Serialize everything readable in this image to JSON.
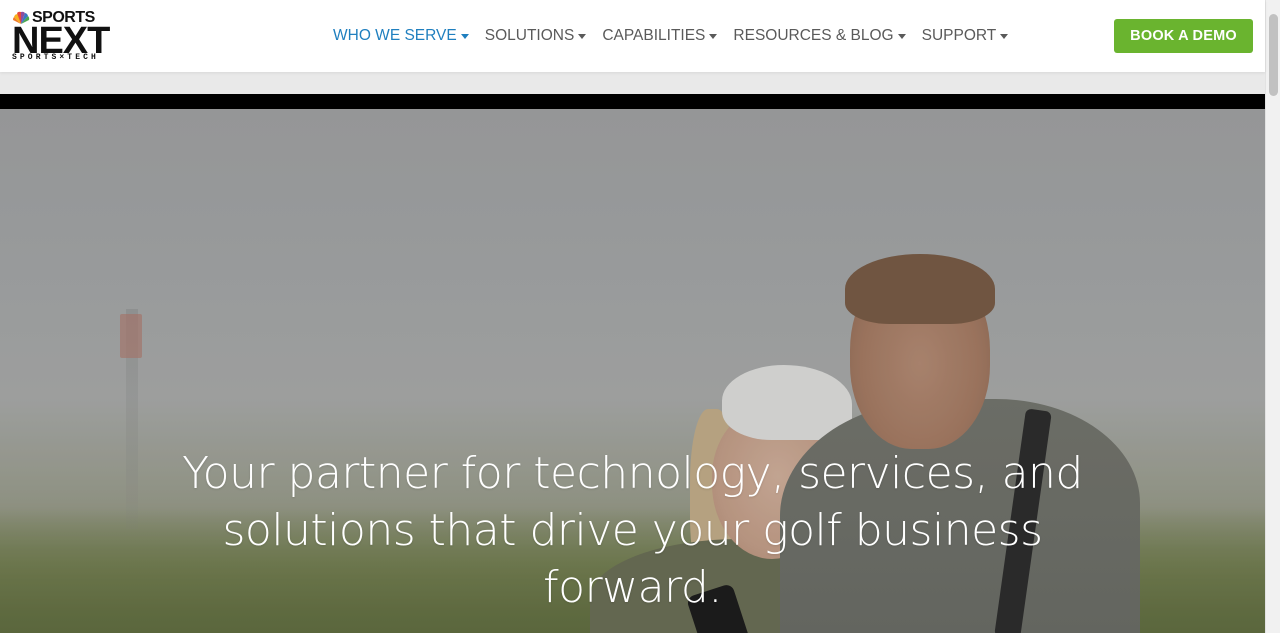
{
  "logo": {
    "top_word": "SPORTS",
    "main_word": "NEXT",
    "sub_text": "SPORTS×TECH",
    "icon": "peacock-icon"
  },
  "nav": {
    "items": [
      {
        "label": "WHO WE SERVE",
        "active": true
      },
      {
        "label": "SOLUTIONS",
        "active": false
      },
      {
        "label": "CAPABILITIES",
        "active": false
      },
      {
        "label": "RESOURCES & BLOG",
        "active": false
      },
      {
        "label": "SUPPORT",
        "active": false
      }
    ],
    "cta_label": "BOOK A DEMO"
  },
  "hero": {
    "headline_line1": "Your partner for technology, services, and",
    "headline_line2": "solutions that drive your golf business forward."
  },
  "colors": {
    "active_nav": "#1f7fbf",
    "nav_text": "#5a5a5a",
    "cta_bg": "#6ab42f"
  }
}
